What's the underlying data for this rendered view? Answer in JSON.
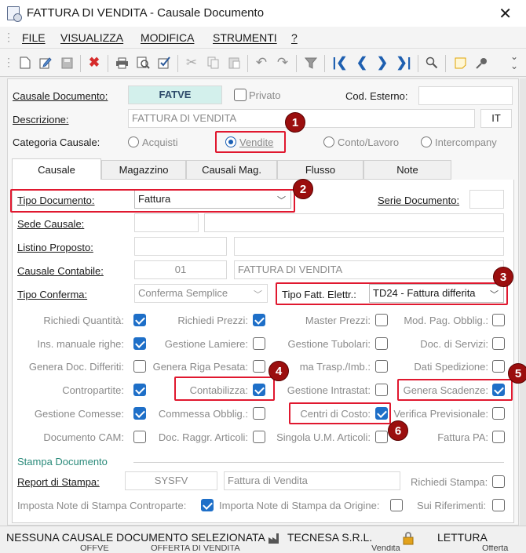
{
  "window": {
    "title": "FATTURA DI VENDITA - Causale Documento",
    "close": "✕"
  },
  "menu": [
    "FILE",
    "VISUALIZZA",
    "MODIFICA",
    "STRUMENTI",
    "?"
  ],
  "toolbar": {
    "overflow": "⌄"
  },
  "header": {
    "causale_label": "Causale Documento:",
    "causale_value": "FATVE",
    "privato_label": "Privato",
    "cod_esterno_label": "Cod. Esterno:",
    "cod_esterno_value": "",
    "descrizione_label": "Descrizione:",
    "descrizione_value": "FATTURA DI VENDITA",
    "lang": "IT",
    "categoria_label": "Categoria Causale:",
    "radios": [
      "Acquisti",
      "Vendite",
      "Conto/Lavoro",
      "Intercompany"
    ],
    "radio_selected": "Vendite"
  },
  "tabs": [
    "Causale",
    "Magazzino",
    "Causali Mag.",
    "Flusso",
    "Note"
  ],
  "form": {
    "tipo_doc_label": "Tipo Documento:",
    "tipo_doc_value": "Fattura",
    "serie_label": "Serie Documento:",
    "serie_value": "",
    "sede_label": "Sede Causale:",
    "listino_label": "Listino Proposto:",
    "caus_cont_label": "Causale Contabile:",
    "caus_cont_code": "01",
    "caus_cont_desc": "FATTURA DI VENDITA",
    "tipo_conf_label": "Tipo Conferma:",
    "tipo_conf_value": "Conferma Semplice",
    "tipo_fatt_label": "Tipo Fatt. Elettr.:",
    "tipo_fatt_value": "TD24 - Fattura differita"
  },
  "checks": [
    {
      "label": "Richiedi Quantità:",
      "checked": true
    },
    {
      "label": "Richiedi Prezzi:",
      "checked": true
    },
    {
      "label": "Master Prezzi:",
      "checked": false
    },
    {
      "label": "Mod. Pag. Obblig.:",
      "checked": false
    },
    {
      "label": "Ins. manuale righe:",
      "checked": true
    },
    {
      "label": "Gestione Lamiere:",
      "checked": false
    },
    {
      "label": "Gestione Tubolari:",
      "checked": false
    },
    {
      "label": "Doc. di Servizi:",
      "checked": false
    },
    {
      "label": "Genera Doc. Differiti:",
      "checked": false
    },
    {
      "label": "Genera Riga Pesata:",
      "checked": false
    },
    {
      "label": "ma Trasp./Imb.:",
      "checked": false
    },
    {
      "label": "Dati Spedizione:",
      "checked": false
    },
    {
      "label": "Contropartite:",
      "checked": true
    },
    {
      "label": "Contabilizza:",
      "checked": true
    },
    {
      "label": "Gestione Intrastat:",
      "checked": false
    },
    {
      "label": "Genera Scadenze:",
      "checked": true
    },
    {
      "label": "Gestione Comesse:",
      "checked": true
    },
    {
      "label": "Commessa Obblig.:",
      "checked": false
    },
    {
      "label": "Centri di Costo:",
      "checked": true
    },
    {
      "label": "Verifica Previsionale:",
      "checked": false
    },
    {
      "label": "Documento CAM:",
      "checked": false
    },
    {
      "label": "Doc. Raggr. Articoli:",
      "checked": false
    },
    {
      "label": "Singola U.M. Articoli:",
      "checked": false
    },
    {
      "label": "Fattura PA:",
      "checked": false
    }
  ],
  "stampa": {
    "section_title": "Stampa Documento",
    "report_label": "Report di Stampa:",
    "report_code": "SYSFV",
    "report_desc": "Fattura di Vendita",
    "richiedi_label": "Richiedi Stampa:",
    "imposta_label": "Imposta Note di Stampa Controparte:",
    "importa_label": "Importa Note di Stampa da Origine:",
    "sui_label": "Sui Riferimenti:"
  },
  "badges": [
    "1",
    "2",
    "3",
    "4",
    "5",
    "6"
  ],
  "status": {
    "message": "NESSUNA CAUSALE DOCUMENTO SELEZIONATA",
    "company": "TECNESA S.R.L.",
    "mode": "LETTURA"
  },
  "background_row": {
    "c1": "OFFVE",
    "c2": "OFFERTA DI VENDITA",
    "c3": "Vendita",
    "c4": "Offerta"
  },
  "colors": {
    "accent": "#1e6fc8",
    "annotation": "#e0182f",
    "badge": "#9b0e0e",
    "code_field": "#d3f0ec"
  }
}
